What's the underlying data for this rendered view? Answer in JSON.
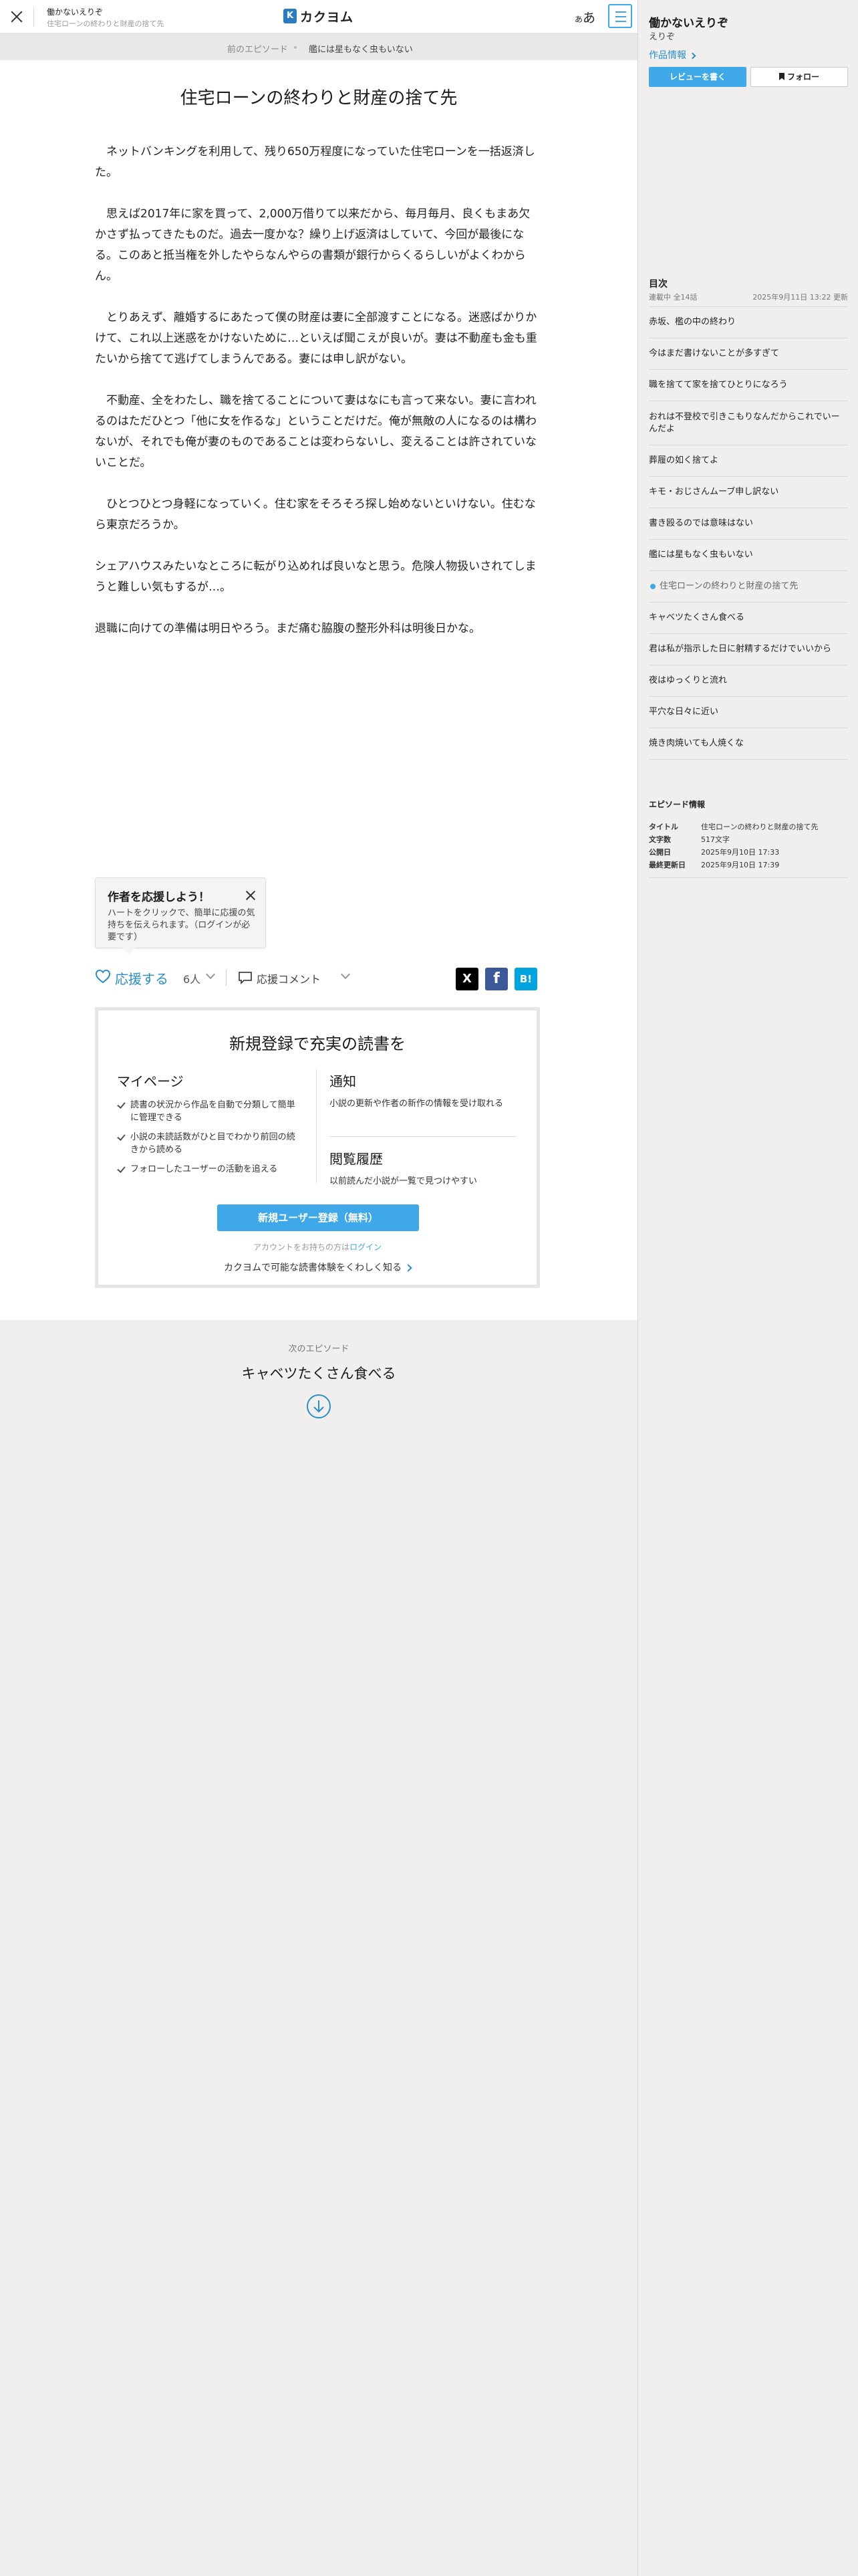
{
  "header": {
    "work_title": "働かないえりぞ",
    "episode_title": "住宅ローンの終わりと財産の捨て先",
    "logo_text": "カクヨム",
    "logo_mark": "K",
    "font_setting_small": "あ",
    "font_setting_large": "あ"
  },
  "episode_nav": {
    "prev_label": "前のエピソード",
    "prev_title": "艦には星もなく虫もいない"
  },
  "episode": {
    "title": "住宅ローンの終わりと財産の捨て先",
    "paragraphs": [
      "　ネットバンキングを利用して、残り650万程度になっていた住宅ローンを一括返済した。",
      "　思えば2017年に家を買って、2,000万借りて以来だから、毎月毎月、良くもまあ欠かさず払ってきたものだ。過去一度かな？繰り上げ返済はしていて、今回が最後になる。このあと抵当権を外したやらなんやらの書類が銀行からくるらしいがよくわからん。",
      "　とりあえず、離婚するにあたって僕の財産は妻に全部渡すことになる。迷惑ばかりかけて、これ以上迷惑をかけないために…といえば聞こえが良いが。妻は不動産も金も重たいから捨てて逃げてしまうんである。妻には申し訳がない。",
      "　不動産、全をわたし、職を捨てることについて妻はなにも言って来ない。妻に言われるのはただひとつ「他に女を作るな」ということだけだ。俺が無敵の人になるのは構わないが、それでも俺が妻のものであることは変わらないし、変えることは許されていないことだ。",
      "　ひとつひとつ身軽になっていく。住む家をそろそろ探し始めないといけない。住むなら東京だろうか。",
      "シェアハウスみたいなところに転がり込めれば良いなと思う。危険人物扱いされてしまうと難しい気もするが…。",
      "退職に向けての準備は明日やろう。まだ痛む脇腹の整形外科は明後日かな。"
    ]
  },
  "cheer_tip": {
    "title": "作者を応援しよう！",
    "body": "ハートをクリックで、簡単に応援の気持ちを伝えられます。（ログインが必要です）"
  },
  "actions": {
    "cheer_label": "応援する",
    "cheer_count": "6人",
    "comment_label": "応援コメント",
    "share_x": "X",
    "share_facebook": "f",
    "share_hatena": "B!"
  },
  "signup": {
    "heading": "新規登録で充実の読書を",
    "mypage_title": "マイページ",
    "mypage_items": [
      "読書の状況から作品を自動で分類して簡単に管理できる",
      "小説の未読話数がひと目でわかり前回の続きから読める",
      "フォローしたユーザーの活動を追える"
    ],
    "notify_title": "通知",
    "notify_desc": "小説の更新や作者の新作の情報を受け取れる",
    "history_title": "閲覧履歴",
    "history_desc": "以前読んだ小説が一覧で見つけやすい",
    "button": "新規ユーザー登録（無料）",
    "login_prefix": "アカウントをお持ちの方は",
    "login_link": "ログイン",
    "learn_more": "カクヨムで可能な読書体験をくわしく知る"
  },
  "next": {
    "label": "次のエピソード",
    "title": "キャベツたくさん食べる"
  },
  "sidebar": {
    "work_title": "働かないえりぞ",
    "author": "えりぞ",
    "work_info_link": "作品情報",
    "review_button": "レビューを書く",
    "follow_button": "フォロー",
    "toc_heading": "目次",
    "toc_status": "連載中 全14話",
    "toc_updated": "2025年9月11日 13:22 更新",
    "toc": [
      "赤坂、檻の中の終わり",
      "今はまだ書けないことが多すぎて",
      "職を捨てて家を捨てひとりになろう",
      "おれは不登校で引きこもりなんだからこれでいーんだよ",
      "葬履の如く捨てよ",
      "キモ・おじさんムーブ申し訳ない",
      "書き殴るのでは意味はない",
      "艦には星もなく虫もいない",
      "住宅ローンの終わりと財産の捨て先",
      "キャベツたくさん食べる",
      "君は私が指示した日に射精するだけでいいから",
      "夜はゆっくりと流れ",
      "平穴な日々に近い",
      "焼き肉焼いても人焼くな"
    ],
    "current_index": 8,
    "episode_info_heading": "エピソード情報",
    "episode_info": [
      {
        "key": "タイトル",
        "value": "住宅ローンの終わりと財産の捨て先"
      },
      {
        "key": "文字数",
        "value": "517文字"
      },
      {
        "key": "公開日",
        "value": "2025年9月10日 17:33"
      },
      {
        "key": "最終更新日",
        "value": "2025年9月10日 17:39"
      }
    ]
  },
  "colors": {
    "accent": "#3ea8e8",
    "link": "#2a8ec8",
    "background": "#f0efed"
  }
}
